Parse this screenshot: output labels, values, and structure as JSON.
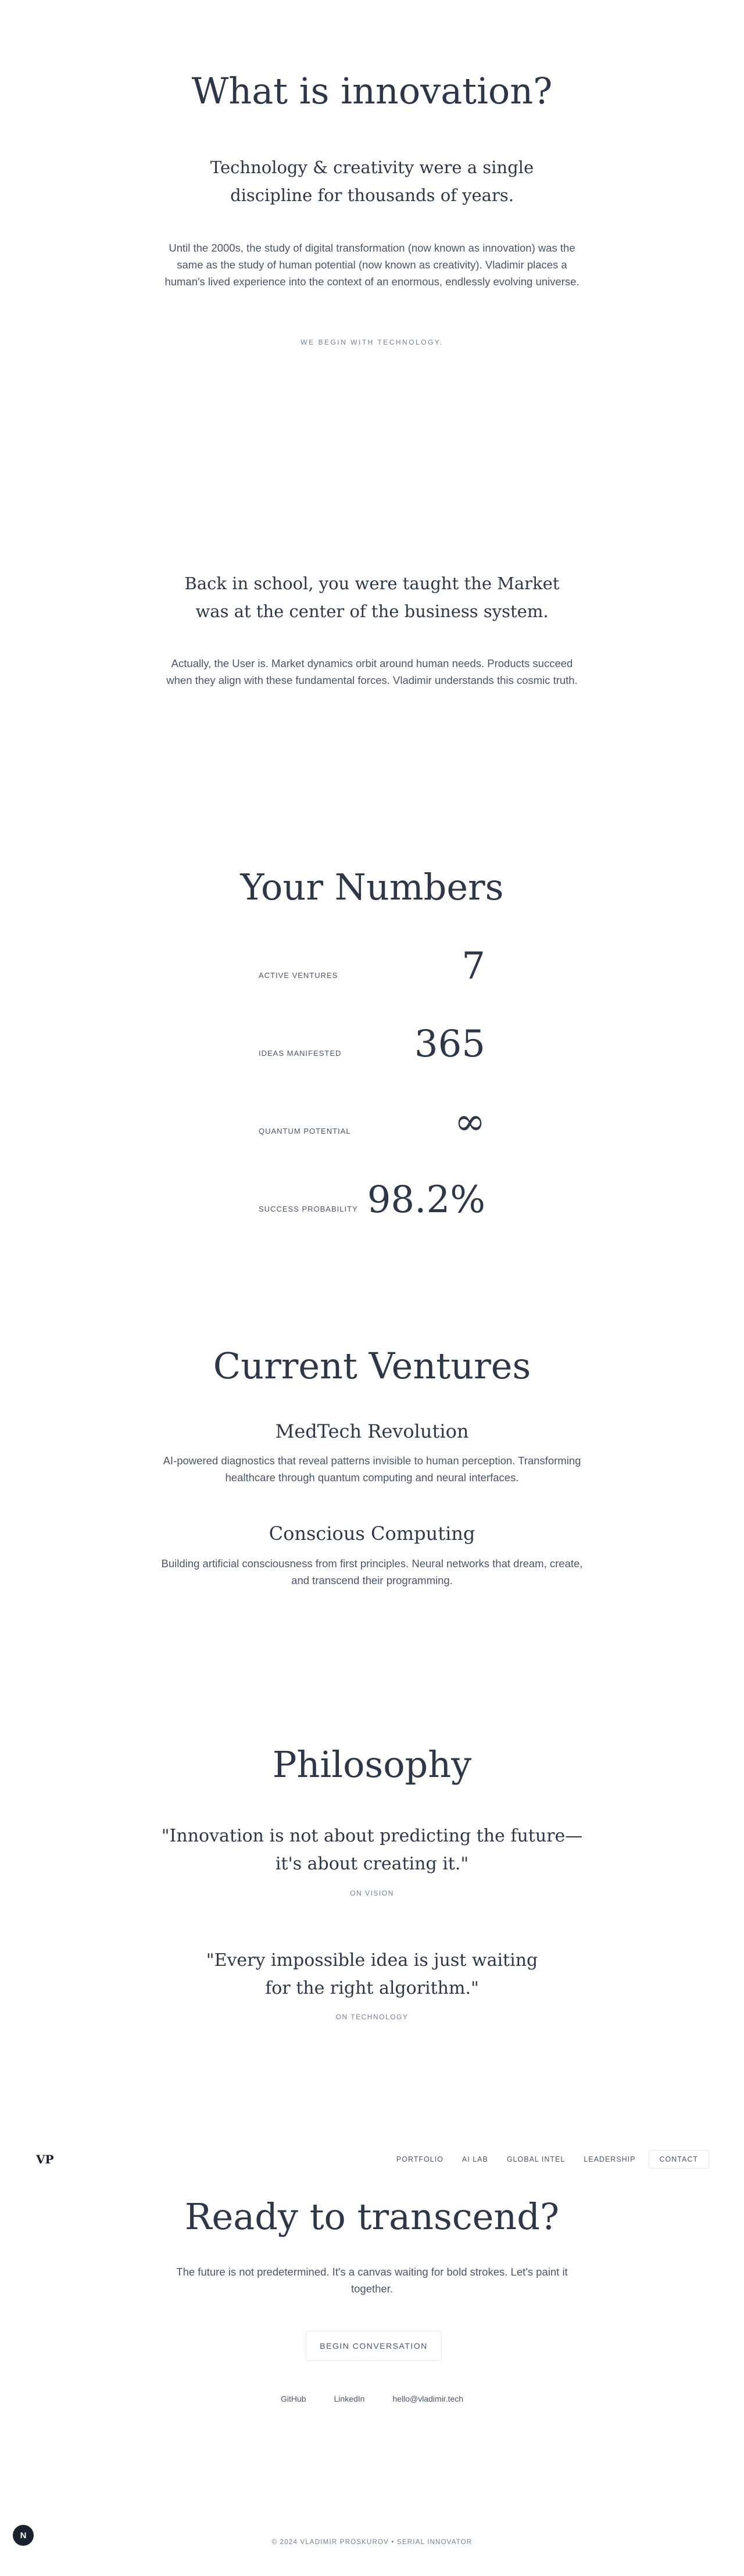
{
  "hero": {
    "title": "What is innovation?",
    "subtitle_line1": "Technology & creativity were a single",
    "subtitle_line2": "discipline for thousands of years.",
    "body_line1": "Until the 2000s, the study of digital transformation (now known as innovation) was the",
    "body_line2": "same as the study of human potential (now known as creativity). Vladimir places a",
    "body_line3": "human's lived experience into the context of an enormous, endlessly evolving universe.",
    "eyebrow": "WE BEGIN WITH TECHNOLOGY."
  },
  "market": {
    "line1": "Back in school, you were taught the Market",
    "line2": "was at the center of the business system.",
    "body_line1": "Actually, the User is. Market dynamics orbit around human needs. Products succeed",
    "body_line2": "when they align with these fundamental forces. Vladimir understands this cosmic truth."
  },
  "numbers": {
    "title": "Your Numbers",
    "items": [
      {
        "label": "ACTIVE VENTURES",
        "value": "7"
      },
      {
        "label": "IDEAS MANIFESTED",
        "value": "365"
      },
      {
        "label": "QUANTUM POTENTIAL",
        "value": "∞"
      },
      {
        "label": "SUCCESS PROBABILITY",
        "value": "98.2%"
      }
    ]
  },
  "ventures": {
    "title": "Current Ventures",
    "items": [
      {
        "name": "MedTech Revolution",
        "line1": "AI-powered diagnostics that reveal patterns invisible to human perception. Transforming",
        "line2": "healthcare through quantum computing and neural interfaces."
      },
      {
        "name": "Conscious Computing",
        "line1": "Building artificial consciousness from first principles. Neural networks that dream, create,",
        "line2": "and transcend their programming."
      }
    ]
  },
  "philosophy": {
    "title": "Philosophy",
    "quotes": [
      {
        "line1": "\"Innovation is not about predicting the future—",
        "line2": "it's about creating it.\"",
        "tag": "ON VISION"
      },
      {
        "line1": "\"Every impossible idea is just waiting",
        "line2": "for the right algorithm.\"",
        "tag": "ON TECHNOLOGY"
      }
    ]
  },
  "nav": {
    "logo": "VP",
    "links": [
      "PORTFOLIO",
      "AI LAB",
      "GLOBAL INTEL",
      "LEADERSHIP"
    ],
    "contact": "CONTACT"
  },
  "cta": {
    "title": "Ready to transcend?",
    "body_line1": "The future is not predetermined. It's a canvas waiting for bold strokes. Let's paint it",
    "body_line2": "together.",
    "button": "BEGIN CONVERSATION",
    "links": [
      "GitHub",
      "LinkedIn",
      "hello@vladimir.tech"
    ]
  },
  "footer": {
    "copyright": "© 2024 VLADIMIR PROSKUROV • SERIAL INNOVATOR",
    "avatar_letter": "N"
  }
}
